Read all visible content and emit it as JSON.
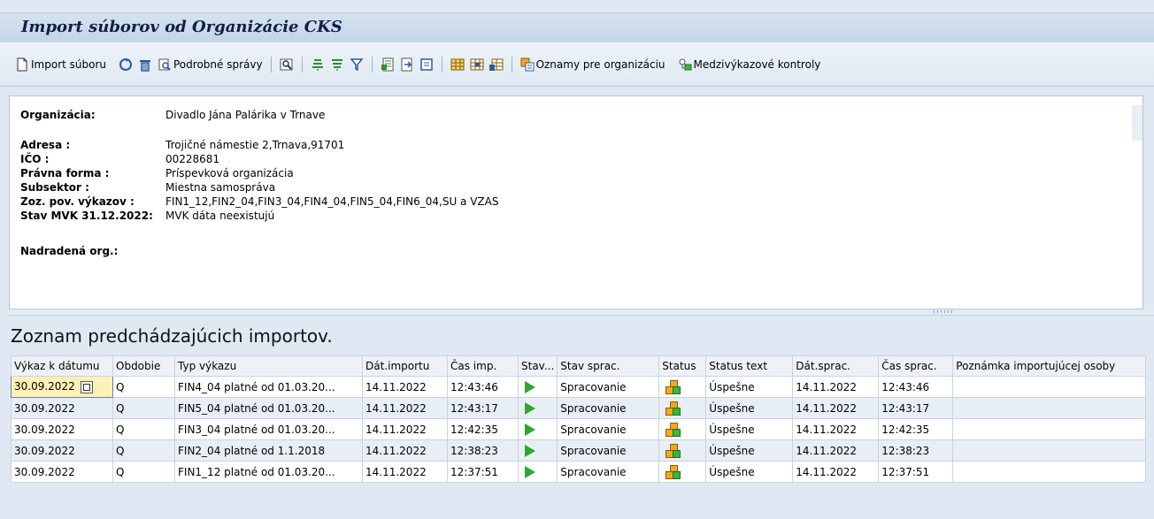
{
  "title": "Import súborov od Organizácie CKS",
  "toolbar": {
    "import_label": "Import súboru",
    "detail_label": "Podrobné správy",
    "notices_label": "Oznamy pre organizáciu",
    "checks_label": "Medzivýkazové kontroly"
  },
  "info": {
    "organizacia_label": "Organizácia:",
    "organizacia_value": "Divadlo Jána Palárika v Trnave",
    "adresa_label": "Adresa :",
    "adresa_value": "Trojičné námestie 2,Trnava,91701",
    "ico_label": "IČO :",
    "ico_value": "00228681",
    "forma_label": "Právna forma :",
    "forma_value": "Príspevková organizácia",
    "subsektor_label": "Subsektor :",
    "subsektor_value": "Miestna samospráva",
    "vykazy_label": "Zoz. pov. výkazov :",
    "vykazy_value": "FIN1_12,FIN2_04,FIN3_04,FIN4_04,FIN5_04,FIN6_04,SU a VZAS",
    "mvk_label": "Stav MVK 31.12.2022:",
    "mvk_value": "MVK dáta neexistujú",
    "nadradena_label": "Nadradená org.:"
  },
  "list": {
    "title": "Zoznam predchádzajúcich importov.",
    "columns": [
      "Výkaz k dátumu",
      "Obdobie",
      "Typ výkazu",
      "Dát.importu",
      "Čas imp.",
      "Stav...",
      "Stav sprac.",
      "Status",
      "Status text",
      "Dát.sprac.",
      "Čas sprac.",
      "Poznámka importujúcej osoby"
    ],
    "rows": [
      {
        "datum": "30.09.2022",
        "obdobie": "Q",
        "typ": "FIN4_04 platné od 01.03.20...",
        "dat_imp": "14.11.2022",
        "cas_imp": "12:43:46",
        "stav_sprac": "Spracovanie",
        "status_text": "Úspešne",
        "dat_sprac": "14.11.2022",
        "cas_sprac": "12:43:46",
        "poznamka": ""
      },
      {
        "datum": "30.09.2022",
        "obdobie": "Q",
        "typ": "FIN5_04 platné od 01.03.20...",
        "dat_imp": "14.11.2022",
        "cas_imp": "12:43:17",
        "stav_sprac": "Spracovanie",
        "status_text": "Úspešne",
        "dat_sprac": "14.11.2022",
        "cas_sprac": "12:43:17",
        "poznamka": ""
      },
      {
        "datum": "30.09.2022",
        "obdobie": "Q",
        "typ": "FIN3_04 platné od 01.03.20...",
        "dat_imp": "14.11.2022",
        "cas_imp": "12:42:35",
        "stav_sprac": "Spracovanie",
        "status_text": "Úspešne",
        "dat_sprac": "14.11.2022",
        "cas_sprac": "12:42:35",
        "poznamka": ""
      },
      {
        "datum": "30.09.2022",
        "obdobie": "Q",
        "typ": "FIN2_04 platné od 1.1.2018",
        "dat_imp": "14.11.2022",
        "cas_imp": "12:38:23",
        "stav_sprac": "Spracovanie",
        "status_text": "Úspešne",
        "dat_sprac": "14.11.2022",
        "cas_sprac": "12:38:23",
        "poznamka": ""
      },
      {
        "datum": "30.09.2022",
        "obdobie": "Q",
        "typ": "FIN1_12 platné od 01.03.20...",
        "dat_imp": "14.11.2022",
        "cas_imp": "12:37:51",
        "stav_sprac": "Spracovanie",
        "status_text": "Úspešne",
        "dat_sprac": "14.11.2022",
        "cas_sprac": "12:37:51",
        "poznamka": ""
      }
    ]
  }
}
